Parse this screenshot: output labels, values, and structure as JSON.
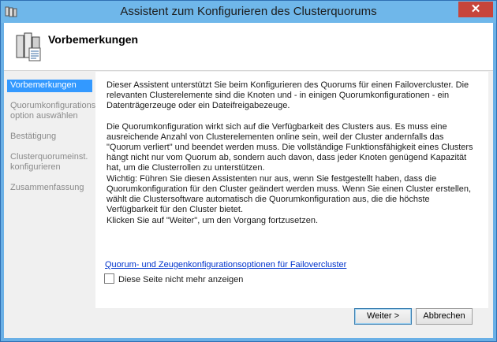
{
  "window": {
    "title": "Assistent zum Konfigurieren des Clusterquorums",
    "close_glyph": "✕"
  },
  "header": {
    "title": "Vorbemerkungen",
    "icon": "cluster-servers-icon"
  },
  "nav": {
    "items": [
      {
        "label": "Vorbemerkungen",
        "active": true
      },
      {
        "label": "Quorumkonfigurations\noption auswählen",
        "active": false
      },
      {
        "label": "Bestätigung",
        "active": false
      },
      {
        "label": "Clusterquorumeinst.\nkonfigurieren",
        "active": false
      },
      {
        "label": "Zusammenfassung",
        "active": false
      }
    ]
  },
  "content": {
    "paragraphs": [
      "Dieser Assistent unterstützt Sie beim Konfigurieren des Quorums für einen Failovercluster. Die relevanten Clusterelemente sind die Knoten und - in einigen Quorumkonfigurationen - ein Datenträgerzeuge oder ein Dateifreigabezeuge.",
      "Die Quorumkonfiguration wirkt sich auf die Verfügbarkeit des Clusters aus. Es muss eine ausreichende Anzahl von Clusterelementen online sein, weil der Cluster andernfalls das \"Quorum verliert\" und beendet werden muss. Die vollständige Funktionsfähigkeit eines Clusters hängt nicht nur vom Quorum ab, sondern auch davon, dass jeder Knoten genügend Kapazität hat, um die Clusterrollen zu unterstützen.",
      "Wichtig: Führen Sie diesen Assistenten nur aus, wenn Sie festgestellt haben, dass die Quorumkonfiguration für den Cluster geändert werden muss. Wenn Sie einen Cluster erstellen, wählt die Clustersoftware automatisch die Quorumkonfiguration aus, die die höchste Verfügbarkeit für den Cluster bietet.",
      "Klicken Sie auf \"Weiter\", um den Vorgang fortzusetzen."
    ],
    "link": "Quorum- und Zeugenkonfigurationsoptionen für Failovercluster",
    "checkbox_label": "Diese Seite nicht mehr anzeigen",
    "checkbox_checked": false
  },
  "buttons": {
    "next": "Weiter >",
    "cancel": "Abbrechen"
  },
  "colors": {
    "titlebar": "#6fb7ea",
    "nav_active": "#3399ff",
    "close": "#c7453b",
    "link": "#0033cc"
  }
}
